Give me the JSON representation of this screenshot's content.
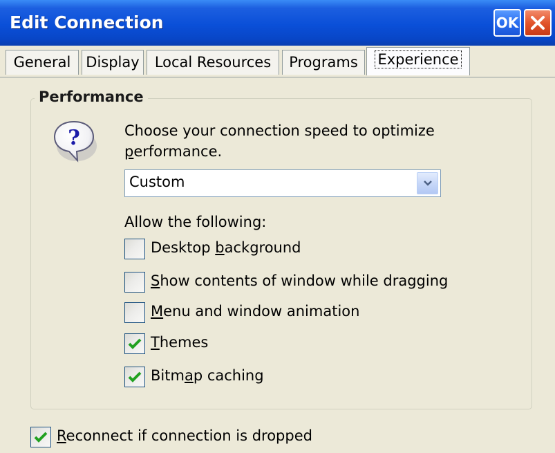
{
  "window": {
    "title": "Edit Connection",
    "ok_label": "OK"
  },
  "tabs": [
    {
      "label": "General",
      "active": false
    },
    {
      "label": "Display",
      "active": false
    },
    {
      "label": "Local Resources",
      "active": false
    },
    {
      "label": "Programs",
      "active": false
    },
    {
      "label": "Experience",
      "active": true
    }
  ],
  "performance": {
    "title": "Performance",
    "description_line1": "Choose your connection speed to optimize",
    "description_line2_accel": "p",
    "description_line2_rest": "erformance.",
    "speed_selected": "Custom",
    "allow_label": "Allow the following:",
    "options": [
      {
        "pre": "Desktop ",
        "accel": "b",
        "post": "ackground",
        "checked": false
      },
      {
        "pre": "",
        "accel": "S",
        "post": "how contents of window while dragging",
        "checked": false
      },
      {
        "pre": "",
        "accel": "M",
        "post": "enu and window animation",
        "checked": false
      },
      {
        "pre": "",
        "accel": "T",
        "post": "hemes",
        "checked": true
      },
      {
        "pre": "Bitm",
        "accel": "a",
        "post": "p caching",
        "checked": true
      }
    ]
  },
  "reconnect": {
    "pre": "",
    "accel": "R",
    "post": "econnect if connection is dropped",
    "checked": true
  },
  "icons": {
    "help": "question-mark-balloon-icon",
    "dropdown": "chevron-down-icon",
    "close": "close-icon",
    "check": "checkmark-icon"
  },
  "colors": {
    "titlebar": "#0a4fd8",
    "background": "#ece9d8",
    "check": "#21a121",
    "close": "#e2542c"
  }
}
